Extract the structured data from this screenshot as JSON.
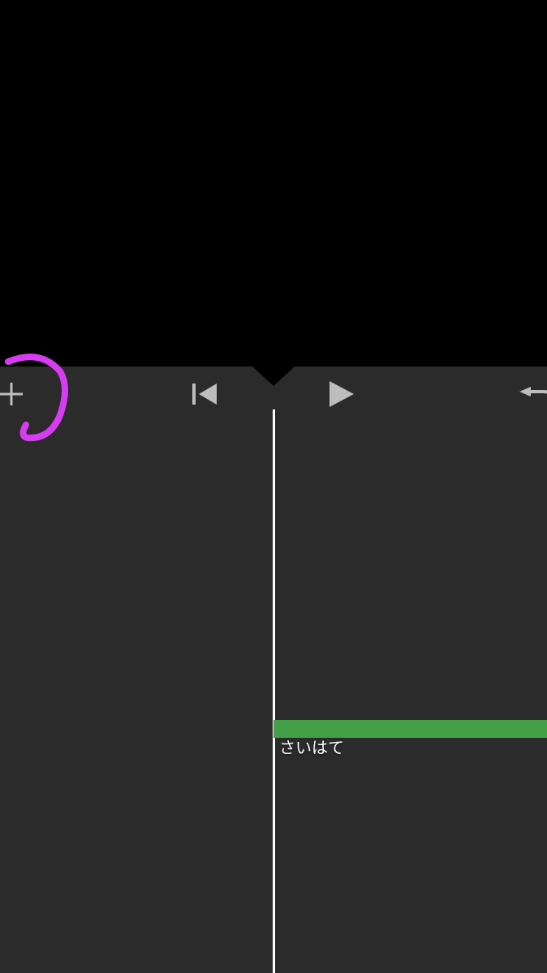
{
  "toolbar": {
    "add": "add",
    "previous": "previous",
    "play": "play",
    "undo": "undo"
  },
  "timeline": {
    "audio_track": {
      "title": "さいはて",
      "color": "#43a047"
    }
  },
  "annotation": {
    "color": "#d63cf0",
    "target": "add-button"
  }
}
